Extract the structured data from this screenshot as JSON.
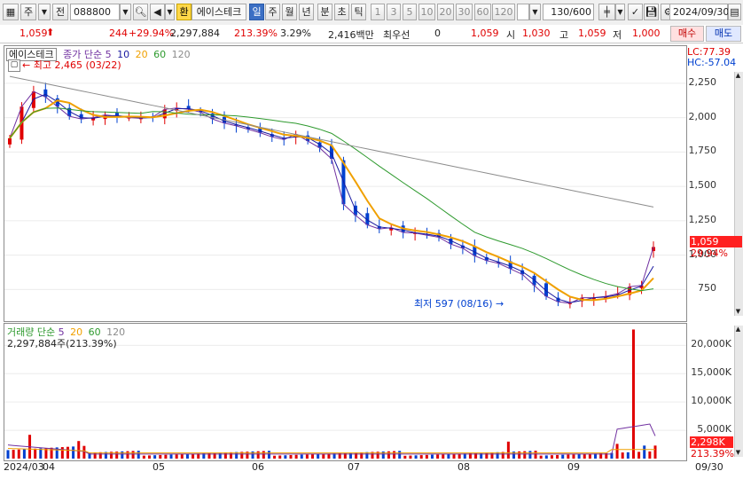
{
  "toolbar": {
    "market": "주",
    "prev": "전",
    "code": "088800",
    "hwan": "환",
    "stock_name": "에이스테크",
    "periods": [
      "일",
      "주",
      "월",
      "년",
      "분",
      "초",
      "틱"
    ],
    "active_period": "일",
    "intervals": [
      "1",
      "3",
      "5",
      "10",
      "20",
      "30",
      "60",
      "120"
    ],
    "count": "130",
    "count_max": "/600",
    "date": "2024/09/30"
  },
  "quote": {
    "price": "1,059",
    "change": "244",
    "change_pct": "+29.94%",
    "volume": "2,297,884",
    "vol_ratio": "213.39%",
    "turnover": "3.29%",
    "amount": "2,416백만",
    "priority_label": "최우선",
    "priority_value": "0",
    "last": "1,059",
    "open_label": "시",
    "open": "1,030",
    "high_label": "고",
    "high": "1,059",
    "low_label": "저",
    "low": "1,000",
    "buy_label": "매수",
    "sell_label": "매도"
  },
  "colors": {
    "up": "#e00000",
    "down": "#0040d0",
    "ma5": "#7030a0",
    "ma10": "#1a1aa0",
    "ma20": "#f0a000",
    "ma60": "#2e9a2e",
    "ma120": "#8c8c8c"
  },
  "price_pane": {
    "name": "에이스테크",
    "legend_label": "종가 단순",
    "ma_periods": [
      "5",
      "10",
      "20",
      "60",
      "120"
    ],
    "lc": "LC:77.39",
    "hc": "HC:-57.04",
    "high_note": "최고 2,465 (03/22)",
    "low_note": "최저 597 (08/16)",
    "last_price": "1,059",
    "last_pct": "29.94%"
  },
  "volume_pane": {
    "legend_label": "거래량 단순",
    "ma_periods": [
      "5",
      "20",
      "60",
      "120"
    ],
    "current": "2,297,884주(213.39%)",
    "last_volume": "2,298K",
    "last_pct": "213.39%"
  },
  "chart_data": [
    {
      "type": "candlestick",
      "title": "에이스테크",
      "y_ticks": [
        2250,
        2000,
        1750,
        1500,
        1250,
        1000,
        750
      ],
      "ylim": [
        520,
        2520
      ],
      "x_labels": [
        "2024/03",
        "04",
        "05",
        "06",
        "07",
        "08",
        "09",
        "09/30"
      ],
      "high_mark": {
        "value": 2465,
        "date": "03/22"
      },
      "low_mark": {
        "value": 597,
        "date": "08/16"
      },
      "last": 1059,
      "closes_approx": [
        1850,
        2080,
        2190,
        2150,
        2080,
        2010,
        1990,
        2000,
        2020,
        2010,
        2000,
        1995,
        2005,
        2060,
        2070,
        2060,
        2040,
        1990,
        1960,
        1940,
        1915,
        1890,
        1860,
        1840,
        1880,
        1830,
        1780,
        1700,
        1370,
        1290,
        1220,
        1190,
        1200,
        1165,
        1160,
        1145,
        1130,
        1080,
        1050,
        995,
        960,
        940,
        900,
        860,
        780,
        700,
        660,
        650,
        690,
        690,
        700,
        720,
        770,
        780,
        1059
      ],
      "series": [
        {
          "name": "5",
          "color": "#7030a0"
        },
        {
          "name": "10",
          "color": "#1a1aa0"
        },
        {
          "name": "20",
          "color": "#f0a000"
        },
        {
          "name": "60",
          "color": "#2e9a2e"
        },
        {
          "name": "120",
          "color": "#8c8c8c"
        }
      ]
    },
    {
      "type": "bar",
      "title": "거래량",
      "y_ticks": [
        20000,
        15000,
        10000,
        5000
      ],
      "y_tick_labels": [
        "20,000K",
        "15,000K",
        "10,000K",
        "5,000K"
      ],
      "ylim": [
        0,
        23500
      ],
      "peak": 22800,
      "last": 2298
    }
  ]
}
